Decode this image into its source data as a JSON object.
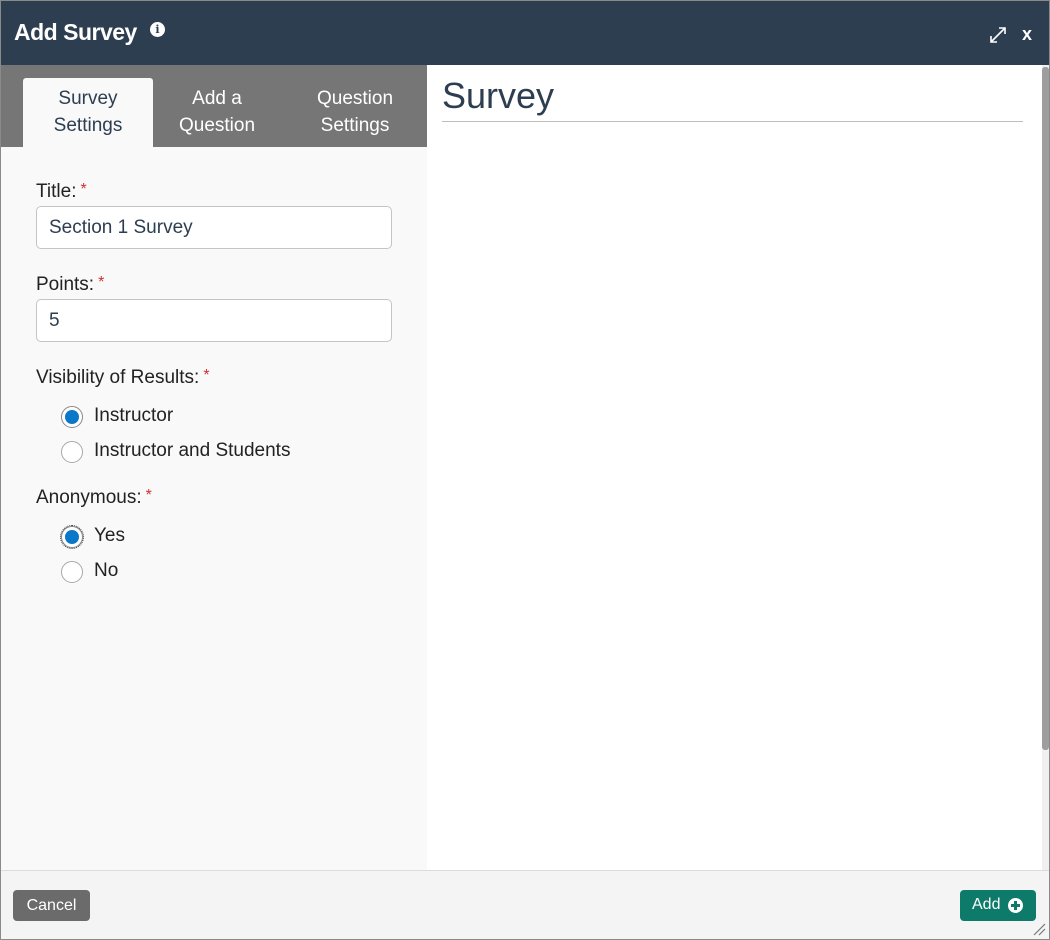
{
  "dialog": {
    "title": "Add Survey",
    "info_icon": "info-icon",
    "expand_icon": "expand-icon",
    "close_label": "x"
  },
  "tabs": [
    {
      "line1": "Survey",
      "line2": "Settings",
      "active": true
    },
    {
      "line1": "Add a",
      "line2": "Question",
      "active": false
    },
    {
      "line1": "Question",
      "line2": "Settings",
      "active": false
    }
  ],
  "form": {
    "title_label": "Title:",
    "title_value": "Section 1 Survey",
    "points_label": "Points:",
    "points_value": "5",
    "required_mark": "*",
    "visibility_label": "Visibility of Results:",
    "visibility_options": [
      {
        "label": "Instructor",
        "checked": true
      },
      {
        "label": "Instructor and Students",
        "checked": false
      }
    ],
    "anonymous_label": "Anonymous:",
    "anonymous_options": [
      {
        "label": "Yes",
        "checked": true
      },
      {
        "label": "No",
        "checked": false
      }
    ]
  },
  "preview": {
    "heading": "Survey"
  },
  "footer": {
    "cancel_label": "Cancel",
    "add_label": "Add",
    "add_icon": "plus-circle-icon"
  },
  "colors": {
    "titlebar": "#2d3e50",
    "tabstrip": "#767676",
    "radio_checked": "#0a77c8",
    "add_button": "#0d7a6a",
    "cancel_button": "#6b6b6b",
    "required": "#d0312d"
  }
}
